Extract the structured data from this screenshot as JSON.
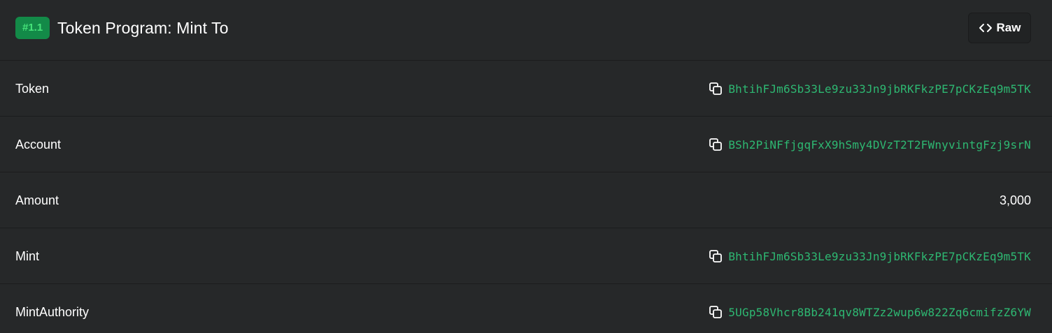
{
  "header": {
    "badge": "#1.1",
    "title": "Token Program: Mint To",
    "raw_label": "Raw"
  },
  "colors": {
    "background": "#262829",
    "badge_bg": "#138a48",
    "badge_text": "#46e27a",
    "address": "#2eb872"
  },
  "rows": [
    {
      "label": "Token",
      "value": "BhtihFJm6Sb33Le9zu33Jn9jbRKFkzPE7pCKzEq9m5TK",
      "icon": "copy-icon"
    },
    {
      "label": "Account",
      "value": "BSh2PiNFfjgqFxX9hSmy4DVzT2T2FWnyvintgFzj9srN",
      "icon": "copy-icon"
    },
    {
      "label": "Amount",
      "value": "3,000"
    },
    {
      "label": "Mint",
      "value": "BhtihFJm6Sb33Le9zu33Jn9jbRKFkzPE7pCKzEq9m5TK",
      "icon": "copy-icon"
    },
    {
      "label": "MintAuthority",
      "value": "5UGp58Vhcr8Bb241qv8WTZz2wup6w822Zq6cmifzZ6YW",
      "icon": "copy-icon"
    }
  ]
}
